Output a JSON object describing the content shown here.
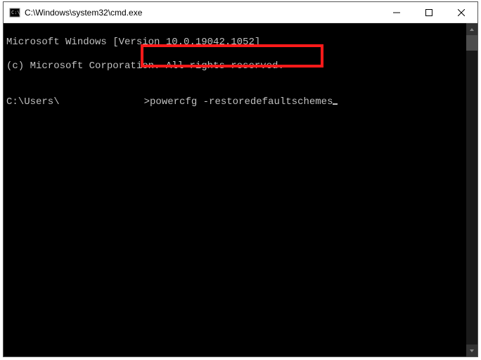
{
  "titlebar": {
    "icon_name": "cmd-icon",
    "title": "C:\\Windows\\system32\\cmd.exe"
  },
  "controls": {
    "minimize_name": "minimize-icon",
    "maximize_name": "maximize-icon",
    "close_name": "close-icon"
  },
  "console": {
    "line1": "Microsoft Windows [Version 10.0.19042.1052]",
    "line2": "(c) Microsoft Corporation. All rights reserved.",
    "prompt_prefix": "C:\\Users\\",
    "prompt_suffix": ">",
    "command": "powercfg -restoredefaultschemes"
  },
  "highlight": {
    "description": "Red rectangle highlighting the powercfg command"
  },
  "scrollbar": {
    "up_name": "scroll-up-icon",
    "down_name": "scroll-down-icon"
  }
}
